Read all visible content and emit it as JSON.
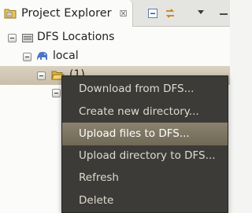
{
  "view": {
    "title": "Project Explorer",
    "close_glyph": "☒",
    "icons": [
      "project-explorer-icon",
      "collapse-all-icon",
      "link-with-editor-icon",
      "view-menu-icon",
      "minimize-icon",
      "maximize-icon"
    ]
  },
  "tree": {
    "nodes": [
      {
        "label": "DFS Locations",
        "icon": "dfs-locations-icon",
        "expanded": true
      },
      {
        "label": "local",
        "icon": "hadoop-elephant-icon",
        "expanded": true
      },
      {
        "label": "(1)",
        "icon": "folder-open-icon",
        "expanded": true,
        "selected": true
      }
    ]
  },
  "context_menu": {
    "items": [
      {
        "label": "Download from DFS..."
      },
      {
        "label": "Create new directory..."
      },
      {
        "label": "Upload files to DFS...",
        "highlighted": true
      },
      {
        "label": "Upload directory to DFS..."
      },
      {
        "label": "Refresh"
      },
      {
        "label": "Delete"
      }
    ]
  }
}
